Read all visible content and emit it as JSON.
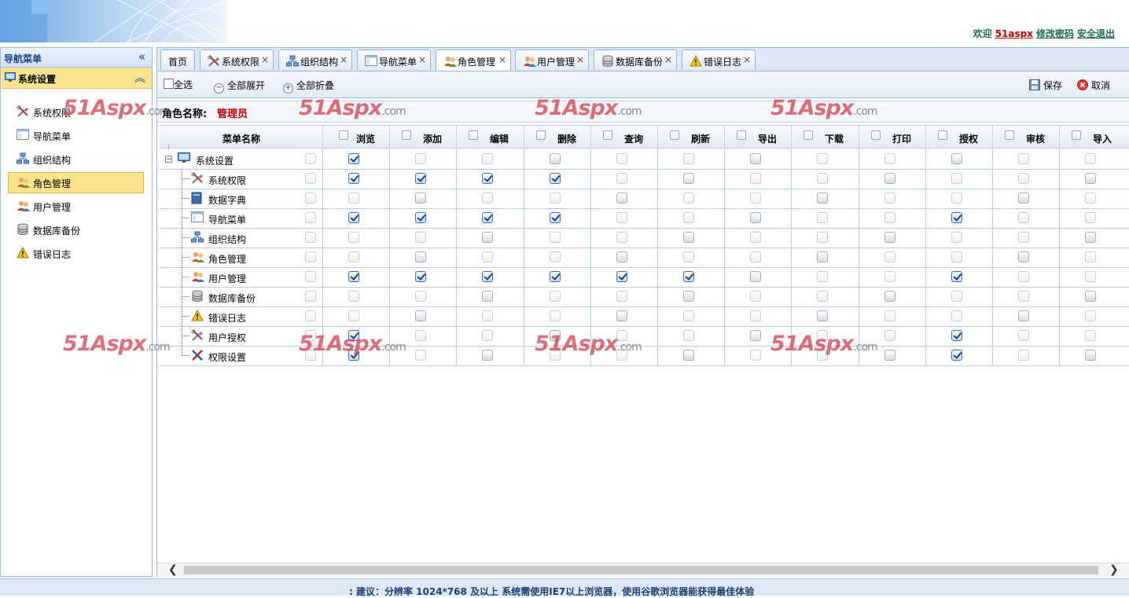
{
  "header": {
    "welcome": "欢迎",
    "user": "51aspx",
    "change_password": "修改密码",
    "logout": "安全退出"
  },
  "sidebar": {
    "title": "导航菜单",
    "section": "系统设置",
    "items": [
      {
        "label": "系统权限",
        "icon": "tools-icon"
      },
      {
        "label": "导航菜单",
        "icon": "menu-window-icon"
      },
      {
        "label": "组织结构",
        "icon": "org-chart-icon"
      },
      {
        "label": "角色管理",
        "icon": "role-users-icon"
      },
      {
        "label": "用户管理",
        "icon": "users-icon"
      },
      {
        "label": "数据库备份",
        "icon": "database-icon"
      },
      {
        "label": "错误日志",
        "icon": "warning-icon"
      }
    ],
    "active": "角色管理"
  },
  "tabs": [
    {
      "label": "首页",
      "closable": false
    },
    {
      "label": "系统权限",
      "closable": true
    },
    {
      "label": "组织结构",
      "closable": true
    },
    {
      "label": "导航菜单",
      "closable": true
    },
    {
      "label": "角色管理",
      "closable": true,
      "active": true
    },
    {
      "label": "用户管理",
      "closable": true
    },
    {
      "label": "数据库备份",
      "closable": true
    },
    {
      "label": "错误日志",
      "closable": true
    }
  ],
  "toolbar": {
    "select_all": "全选",
    "expand_all": "全部展开",
    "collapse_all": "全部折叠",
    "save": "保存",
    "cancel": "取消"
  },
  "role": {
    "label": "角色名称:",
    "value": "管理员"
  },
  "grid": {
    "name_header": "菜单名称",
    "columns": [
      "浏览",
      "添加",
      "编辑",
      "删除",
      "查询",
      "刷新",
      "导出",
      "下载",
      "打印",
      "授权",
      "审核",
      "导入"
    ],
    "rows": [
      {
        "name": "系统设置",
        "level": 0,
        "icon": "monitor-icon",
        "perms": [
          1,
          0,
          0,
          0,
          0,
          0,
          0,
          0,
          0,
          0,
          0,
          0
        ]
      },
      {
        "name": "系统权限",
        "level": 1,
        "icon": "tools-icon",
        "perms": [
          1,
          1,
          1,
          1,
          0,
          0,
          0,
          0,
          0,
          0,
          0,
          0
        ]
      },
      {
        "name": "数据字典",
        "level": 1,
        "icon": "book-icon",
        "perms": [
          0,
          0,
          0,
          0,
          0,
          0,
          0,
          0,
          0,
          0,
          0,
          0
        ]
      },
      {
        "name": "导航菜单",
        "level": 1,
        "icon": "menu-window-icon",
        "perms": [
          1,
          1,
          1,
          1,
          0,
          0,
          0,
          0,
          0,
          1,
          0,
          0
        ]
      },
      {
        "name": "组织结构",
        "level": 1,
        "icon": "org-chart-icon",
        "perms": [
          0,
          0,
          0,
          0,
          0,
          0,
          0,
          0,
          0,
          0,
          0,
          0
        ]
      },
      {
        "name": "角色管理",
        "level": 1,
        "icon": "role-users-icon",
        "perms": [
          0,
          0,
          0,
          0,
          0,
          0,
          0,
          0,
          0,
          0,
          0,
          0
        ]
      },
      {
        "name": "用户管理",
        "level": 1,
        "icon": "users-icon",
        "perms": [
          1,
          1,
          1,
          1,
          1,
          1,
          0,
          0,
          0,
          1,
          0,
          0
        ]
      },
      {
        "name": "数据库备份",
        "level": 1,
        "icon": "database-icon",
        "perms": [
          0,
          0,
          0,
          0,
          0,
          0,
          0,
          0,
          0,
          0,
          0,
          0
        ]
      },
      {
        "name": "错误日志",
        "level": 1,
        "icon": "warning-icon",
        "perms": [
          0,
          0,
          0,
          0,
          0,
          0,
          0,
          0,
          0,
          0,
          0,
          0
        ]
      },
      {
        "name": "用户授权",
        "level": 1,
        "icon": "tools-icon",
        "perms": [
          1,
          0,
          0,
          0,
          0,
          0,
          0,
          0,
          0,
          1,
          0,
          0
        ]
      },
      {
        "name": "权限设置",
        "level": 1,
        "icon": "pen-tools-icon",
        "perms": [
          1,
          0,
          0,
          0,
          0,
          0,
          0,
          0,
          0,
          1,
          0,
          0
        ]
      }
    ]
  },
  "footer": {
    "text": ": 建议：分辨率  1024*768 及以上      系统需使用IE7以上浏览器，使用谷歌浏览器能获得最佳体验"
  },
  "watermark": {
    "brand": "51Aspx",
    "suffix": ".com"
  },
  "colors": {
    "accent": "#15428b",
    "highlight": "#fbe48d",
    "role_value": "#c00000",
    "border": "#99bbe8"
  }
}
